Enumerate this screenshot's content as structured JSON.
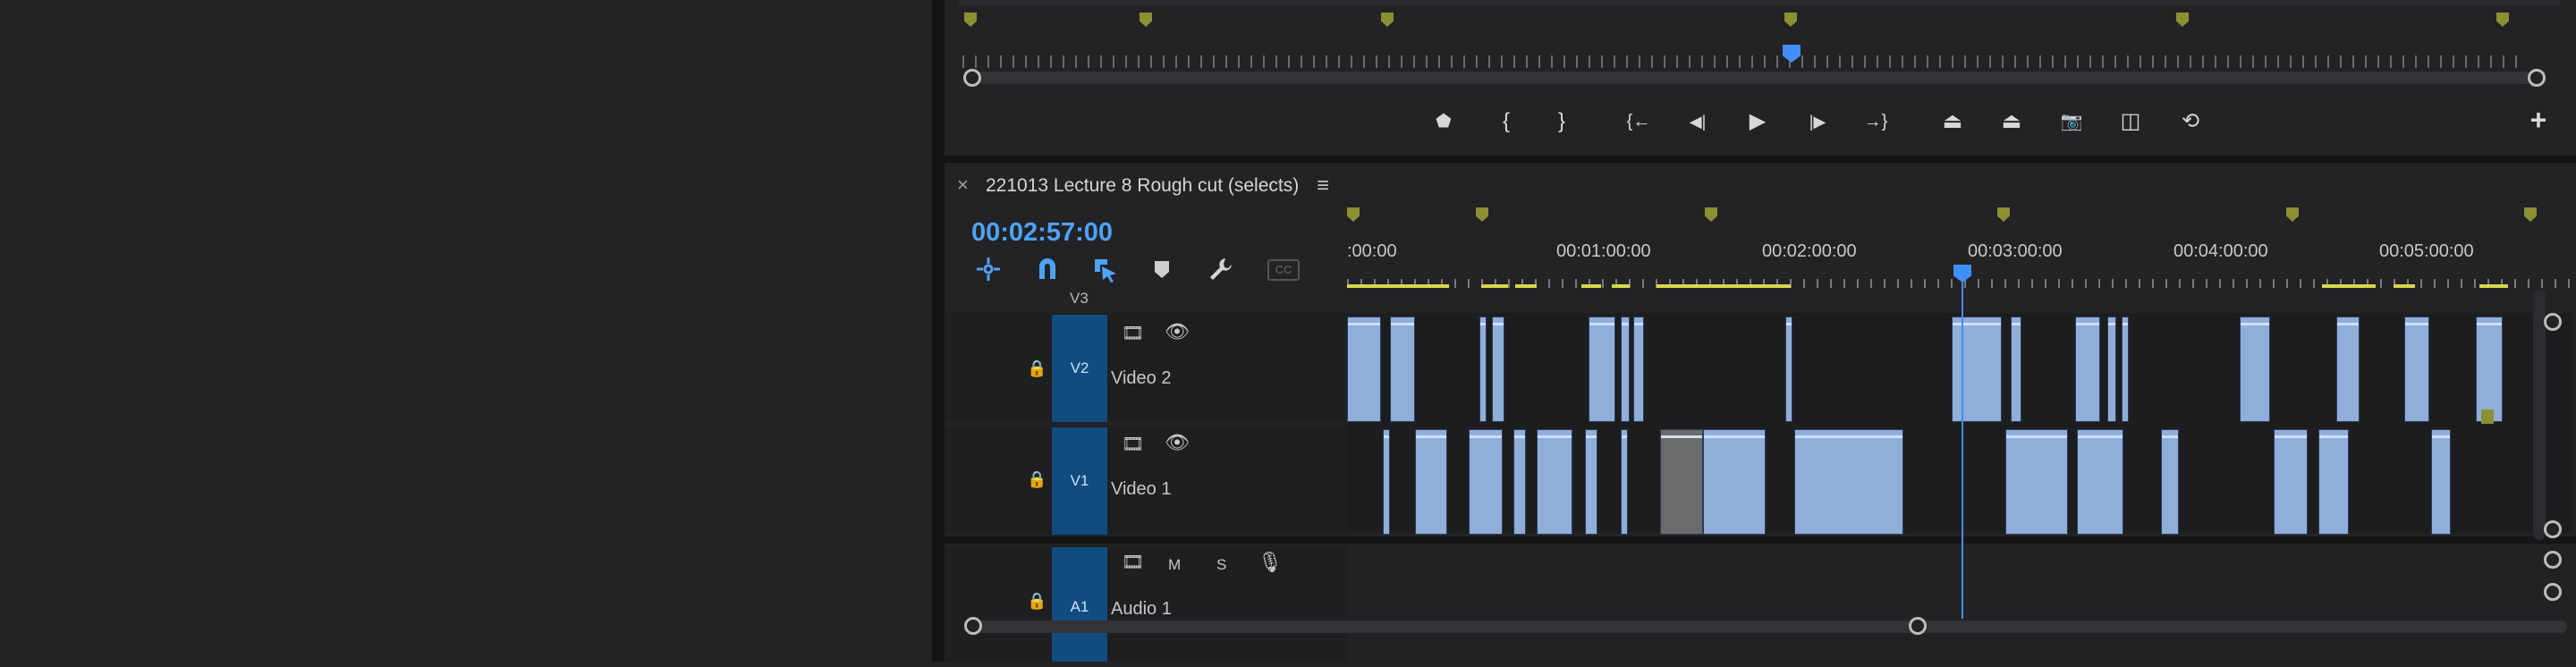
{
  "program_monitor": {
    "controls": [
      {
        "name": "add-marker-button",
        "glyph": "⬟"
      },
      {
        "name": "mark-in-button",
        "glyph": "{"
      },
      {
        "name": "mark-out-button",
        "glyph": "}"
      },
      {
        "name": "go-to-in-button",
        "glyph": "{←"
      },
      {
        "name": "step-back-button",
        "glyph": "◀|"
      },
      {
        "name": "play-button",
        "glyph": "▶"
      },
      {
        "name": "step-forward-button",
        "glyph": "|▶"
      },
      {
        "name": "go-to-out-button",
        "glyph": "→}"
      },
      {
        "name": "lift-button",
        "glyph": "⏏"
      },
      {
        "name": "extract-button",
        "glyph": "⏏"
      },
      {
        "name": "export-frame-button",
        "glyph": "📷"
      },
      {
        "name": "comparison-view-button",
        "glyph": "◫"
      },
      {
        "name": "toggle-proxies-button",
        "glyph": "⟲"
      }
    ],
    "add_button": "+"
  },
  "timeline": {
    "close_glyph": "×",
    "sequence_title": "221013 Lecture 8 Rough cut (selects)",
    "menu_glyph": "≡",
    "timecode": "00:02:57:00",
    "ruler_labels": [
      ":00:00",
      "00:01:00:00",
      "00:02:00:00",
      "00:03:00:00",
      "00:04:00:00",
      "00:05:00:00"
    ],
    "tools": {
      "cc_label": "CC"
    },
    "tracks": {
      "v3": {
        "tag": "V3"
      },
      "v2": {
        "tag": "V2",
        "name": "Video 2"
      },
      "v1": {
        "tag": "V1",
        "name": "Video 1"
      },
      "a1": {
        "tag": "A1",
        "name": "Audio 1",
        "m_label": "M",
        "s_label": "S"
      }
    }
  },
  "colors": {
    "accent": "#3f8ff7",
    "clip": "#8faeda",
    "marker": "#8c8f32",
    "track_tag": "#104c80"
  }
}
